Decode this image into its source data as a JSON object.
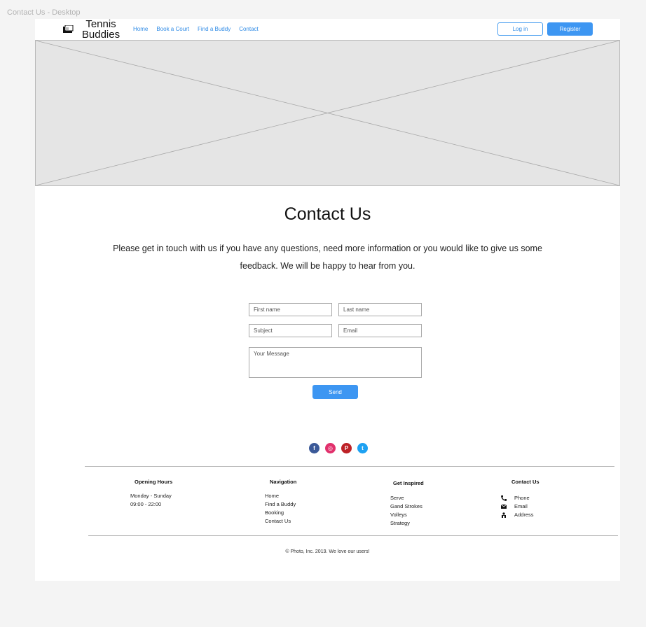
{
  "frame_label": "Contact Us - Desktop",
  "header": {
    "logo_line1": "Tennis",
    "logo_line2": "Buddies",
    "nav": [
      "Home",
      "Book a Court",
      "Find a  Buddy",
      "Contact"
    ],
    "login_label": "Log in",
    "register_label": "Register"
  },
  "main": {
    "title": "Contact Us",
    "intro": "Please get in touch with us if you have any questions, need more information or you would like to give us some feedback. We will be happy to hear from you.",
    "form": {
      "first_name": "First name",
      "last_name": "Last name",
      "subject": "Subject",
      "email": "Email",
      "message": "Your Message",
      "send_label": "Send"
    }
  },
  "social": [
    {
      "name": "facebook-icon",
      "glyph": "f",
      "color": "#3b5998"
    },
    {
      "name": "instagram-icon",
      "glyph": "◎",
      "color": "#e1306c"
    },
    {
      "name": "pinterest-icon",
      "glyph": "P",
      "color": "#bd2126"
    },
    {
      "name": "twitter-icon",
      "glyph": "t",
      "color": "#1da1f2"
    }
  ],
  "footer": {
    "hours": {
      "title": "Opening Hours",
      "days": "Monday - Sunday",
      "time": "09:00 - 22:00"
    },
    "navigation": {
      "title": "Navigation",
      "items": [
        "Home",
        "Find a Buddy",
        "Booking",
        "Contact Us"
      ]
    },
    "inspired": {
      "title": "Get Inspired",
      "items": [
        "Serve",
        "Gand Strokes",
        "Volleys",
        "Strategy"
      ]
    },
    "contact": {
      "title": "Contact Us",
      "phone": "Phone",
      "email": "Email",
      "address": "Address"
    },
    "copyright": "© Photo, Inc. 2019. We love our users!"
  },
  "colors": {
    "accent": "#3d96f2",
    "link": "#2f8be6",
    "placeholder_bg": "#e5e5e5"
  }
}
